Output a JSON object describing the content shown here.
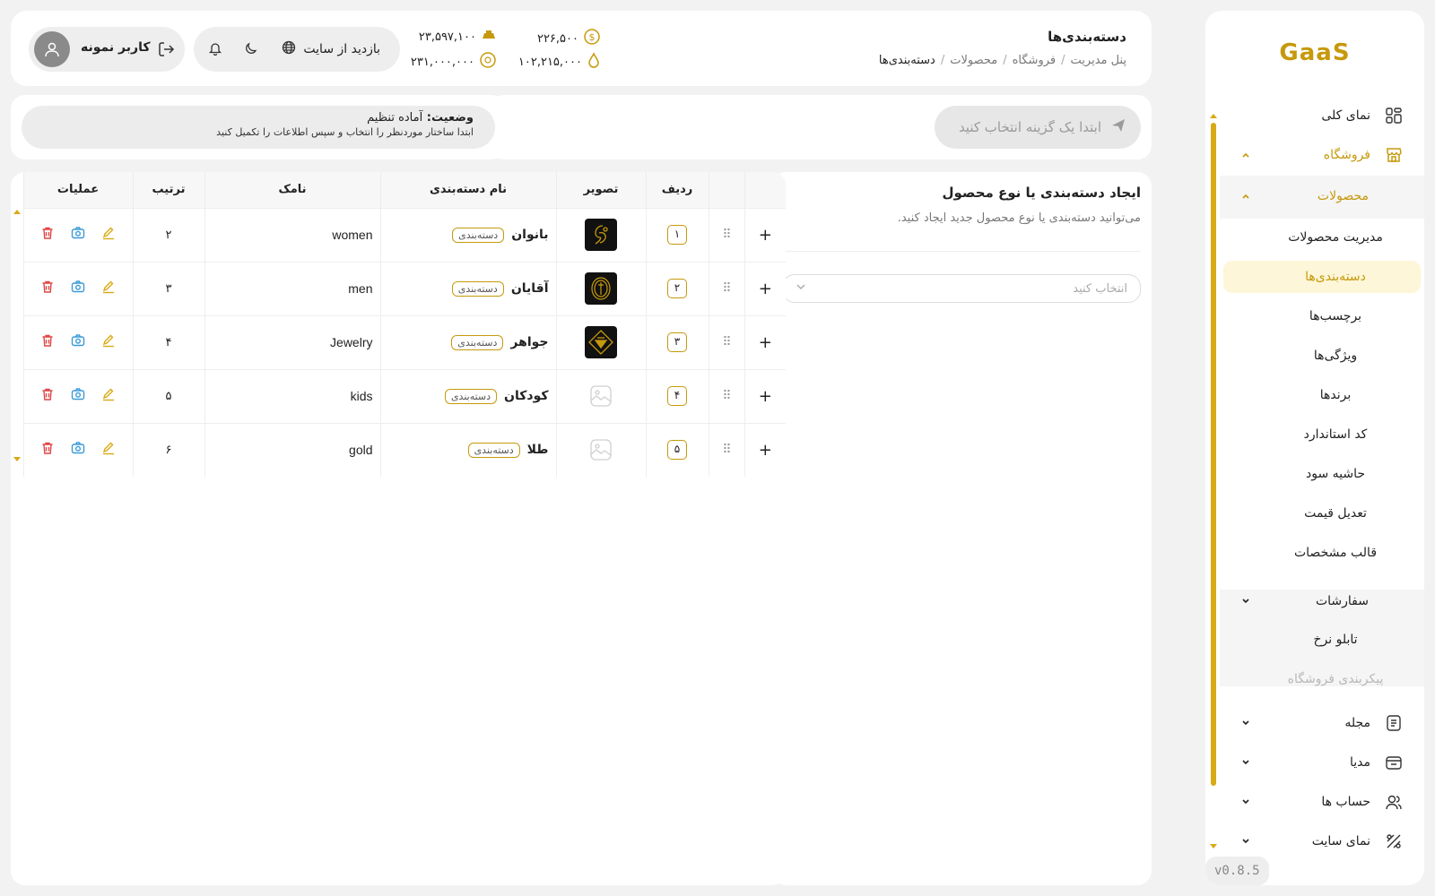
{
  "brand": "GaaS",
  "version": "v0.8.5",
  "sidebar": {
    "items": [
      {
        "label": "نمای کلی",
        "icon": "dashboard-icon"
      },
      {
        "label": "فروشگاه",
        "icon": "store-icon"
      },
      {
        "label": "محصولات"
      },
      {
        "label": "سفارشات"
      },
      {
        "label": "مجله",
        "icon": "magazine-icon"
      },
      {
        "label": "مدیا",
        "icon": "media-icon"
      },
      {
        "label": "حساب ها",
        "icon": "accounts-icon"
      },
      {
        "label": "نمای سایت",
        "icon": "site-view-icon"
      }
    ],
    "products_sub": [
      "مدیریت محصولات",
      "دسته‌بندی‌ها",
      "برچسب‌ها",
      "ویژگی‌ها",
      "برندها",
      "کد استاندارد",
      "حاشیه سود",
      "تعدیل قیمت",
      "قالب مشخصات"
    ],
    "store_sub": [
      "تابلو نرخ",
      "پیکربندی فروشگاه"
    ]
  },
  "header": {
    "title": "دسته‌بندی‌ها",
    "breadcrumb": [
      "پنل مدیریت",
      "فروشگاه",
      "محصولات",
      "دسته‌بندی‌ها"
    ],
    "stats": {
      "dollar": "۲۲۶,۵۰۰",
      "gold_bar": "۲۳,۵۹۷,۱۰۰",
      "drop": "۱۰۲,۲۱۵,۰۰۰",
      "coin": "۲۳۱,۰۰۰,۰۰۰"
    },
    "visit_site": "بازدید از سایت",
    "username": "کاربر نمونه"
  },
  "actionbar": {
    "placeholder": "ابتدا یک گزینه انتخاب کنید"
  },
  "status": {
    "label": "وضعیت:",
    "value": "آماده تنظیم",
    "hint": "ابتدا ساختار موردنظر را انتخاب و سپس اطلاعات را تکمیل کنید"
  },
  "create_panel": {
    "title": "ایجاد دسته‌بندی یا نوع محصول",
    "description": "می‌توانید دسته‌بندی یا نوع محصول جدید ایجاد کنید.",
    "select_placeholder": "انتخاب کنید"
  },
  "table": {
    "headers": [
      "ردیف",
      "تصویر",
      "نام دسته‌بندی",
      "نامک",
      "ترتیب",
      "عملیات"
    ],
    "tag_label": "دسته‌بندی",
    "rows": [
      {
        "index": "۱",
        "name": "بانوان",
        "slug": "women",
        "order": "۲",
        "has_image": true
      },
      {
        "index": "۲",
        "name": "آقایان",
        "slug": "men",
        "order": "۳",
        "has_image": true
      },
      {
        "index": "۳",
        "name": "جواهر",
        "slug": "Jewelry",
        "order": "۴",
        "has_image": true
      },
      {
        "index": "۴",
        "name": "کودکان",
        "slug": "kids",
        "order": "۵",
        "has_image": false
      },
      {
        "index": "۵",
        "name": "طلا",
        "slug": "gold",
        "order": "۶",
        "has_image": false
      }
    ]
  },
  "colors": {
    "accent": "#c6990c",
    "delete": "#e04545",
    "camera": "#3a9ad9",
    "edit": "#d8aa15"
  }
}
